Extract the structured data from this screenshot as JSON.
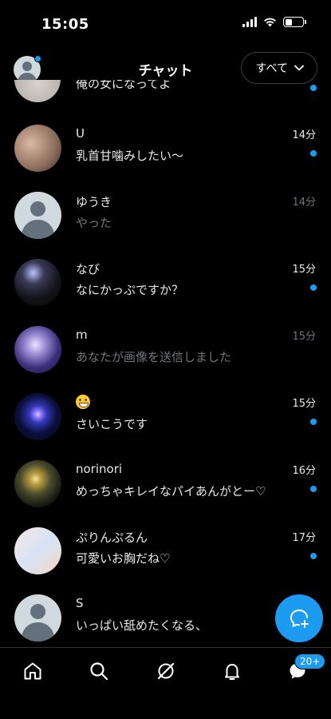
{
  "status_bar": {
    "time": "15:05"
  },
  "header": {
    "title": "チャット",
    "filter_label": "すべて"
  },
  "partial_row": {
    "text": "俺の女になってよ"
  },
  "conversations": [
    {
      "name": "U",
      "time": "14分",
      "message": "乳首甘噛みしたい〜",
      "unread": true,
      "avatar": "photo"
    },
    {
      "name": "ゆうき",
      "time": "14分",
      "message": "やった",
      "unread": false,
      "avatar": "default"
    },
    {
      "name": "なび",
      "time": "15分",
      "message": "なにかっぷですか？",
      "unread": true,
      "avatar": "photo"
    },
    {
      "name": "m",
      "time": "15分",
      "message": "あなたが画像を送信しました",
      "unread": false,
      "avatar": "photo"
    },
    {
      "name": "😁",
      "time": "15分",
      "message": "さいこうです",
      "unread": true,
      "avatar": "photo"
    },
    {
      "name": "norinori",
      "time": "16分",
      "message": "めっちゃキレイなパイあんがとー♡",
      "unread": true,
      "avatar": "photo"
    },
    {
      "name": "ぷりんぷるん",
      "time": "17分",
      "message": "可愛いお胸だね♡",
      "unread": true,
      "avatar": "photo"
    },
    {
      "name": "S",
      "time": "",
      "message": "いっぱい舐めたくなる、",
      "unread": false,
      "avatar": "default"
    }
  ],
  "bottom_nav": {
    "items": [
      "home-icon",
      "search-icon",
      "grok-icon",
      "bell-icon",
      "messages-icon"
    ],
    "messages_badge": "20+"
  },
  "fab": {
    "icon": "new-message-icon"
  },
  "colors": {
    "accent": "#1d9bf0",
    "muted": "#71767b",
    "background": "#000000"
  }
}
